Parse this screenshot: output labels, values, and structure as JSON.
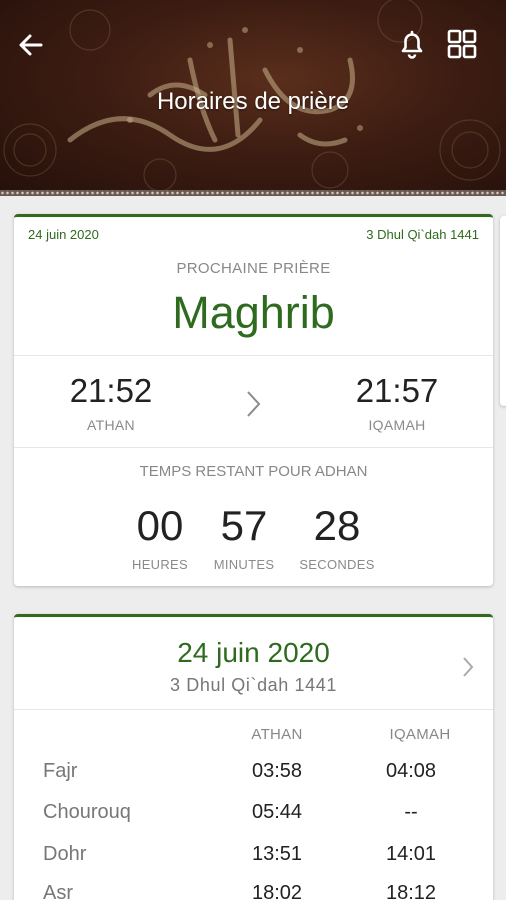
{
  "header": {
    "title": "Horaires de prière",
    "back_icon": "arrow-left-icon",
    "bell_icon": "bell-icon",
    "grid_icon": "grid-icon"
  },
  "next_prayer_card": {
    "gregorian_date": "24 juin 2020",
    "hijri_date": "3 Dhul Qi`dah 1441",
    "label": "PROCHAINE PRIÈRE",
    "prayer": "Maghrib",
    "athan_time": "21:52",
    "athan_label": "ATHAN",
    "iqamah_time": "21:57",
    "iqamah_label": "IQAMAH",
    "remaining_label": "TEMPS RESTANT POUR ADHAN",
    "countdown": {
      "hours": "00",
      "hours_label": "HEURES",
      "minutes": "57",
      "minutes_label": "MINUTES",
      "seconds": "28",
      "seconds_label": "SECONDES"
    }
  },
  "schedule_card": {
    "date": "24 juin 2020",
    "hijri": "3 Dhul Qi`dah 1441",
    "col_athan": "ATHAN",
    "col_iqamah": "IQAMAH",
    "rows": [
      {
        "name": "Fajr",
        "athan": "03:58",
        "iqamah": "04:08"
      },
      {
        "name": "Chourouq",
        "athan": "05:44",
        "iqamah": "--"
      },
      {
        "name": "Dohr",
        "athan": "13:51",
        "iqamah": "14:01"
      },
      {
        "name": "Asr",
        "athan": "18:02",
        "iqamah": "18:12"
      }
    ]
  },
  "colors": {
    "accent": "#2e6b1f",
    "header_bg": "#3d1d12"
  }
}
